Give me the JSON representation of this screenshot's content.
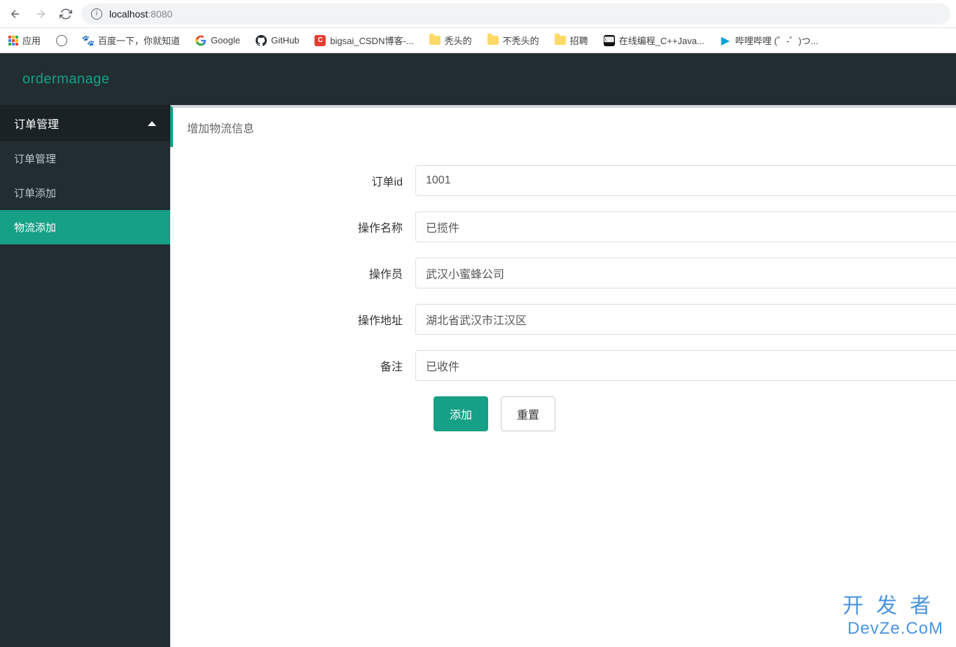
{
  "browser": {
    "url_host": "localhost",
    "url_port": ":8080"
  },
  "bookmarks": {
    "apps": "应用",
    "baidu": "百度一下，你就知道",
    "google": "Google",
    "github": "GitHub",
    "csdn": "bigsai_CSDN博客-...",
    "bald": "秃头的",
    "notbald": "不秃头的",
    "recruit": "招聘",
    "onlinecode": "在线编程_C++Java...",
    "bilibili": "哔哩哔哩 (゜-゜)つ..."
  },
  "header": {
    "brand": "ordermanage"
  },
  "sidebar": {
    "group": "订单管理",
    "items": [
      "订单管理",
      "订单添加",
      "物流添加"
    ]
  },
  "panel": {
    "title": "增加物流信息"
  },
  "form": {
    "order_id": {
      "label": "订单id",
      "value": "1001"
    },
    "op_name": {
      "label": "操作名称",
      "value": "已揽件"
    },
    "operator": {
      "label": "操作员",
      "value": "武汉小蜜蜂公司"
    },
    "op_addr": {
      "label": "操作地址",
      "value": "湖北省武汉市江汉区"
    },
    "remark": {
      "label": "备注",
      "value": "已收件"
    },
    "submit": "添加",
    "reset": "重置"
  },
  "watermark": {
    "l1": "开发者",
    "l2": "DevZe.CoM"
  }
}
